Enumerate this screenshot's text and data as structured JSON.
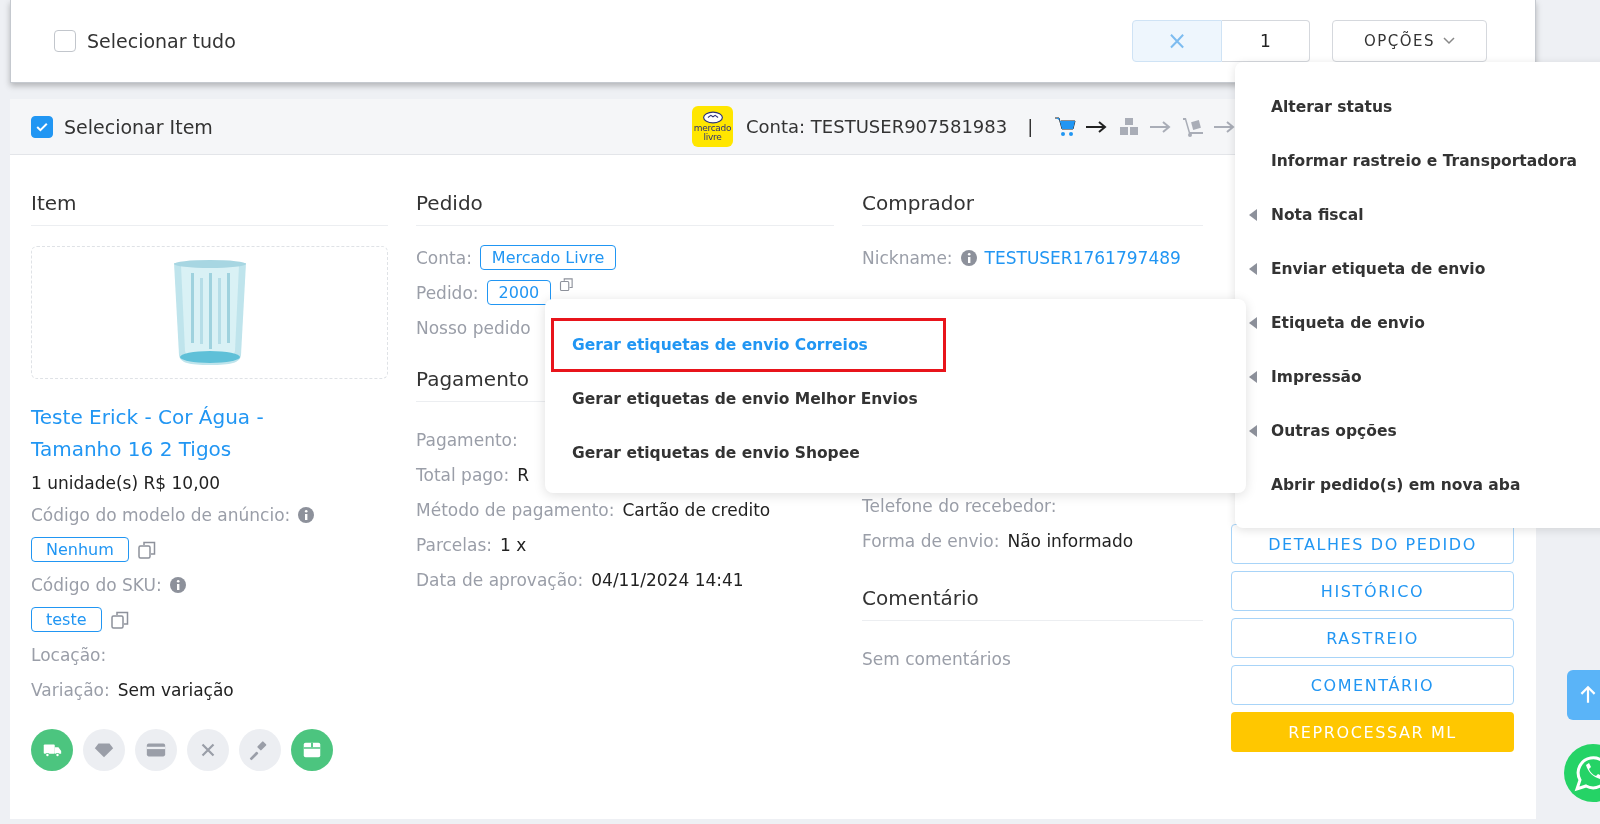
{
  "toolbar": {
    "select_all": {
      "label": "Selecionar tudo",
      "checked": false
    },
    "clear_label": "×",
    "count": "1",
    "options_label": "OPÇÕES"
  },
  "order": {
    "select": {
      "label": "Selecionar Item",
      "checked": true
    },
    "logo_text": "mercado livre",
    "account": "Conta: TESTUSER907581983",
    "separator": "|",
    "status_steps": [
      {
        "kind": "cart",
        "done": true
      },
      {
        "kind": "boxes",
        "done": false
      },
      {
        "kind": "dolly",
        "done": false
      }
    ]
  },
  "item": {
    "title": "Item",
    "product_name": "Teste Erick - Cor Água - Tamanho 16 2 Tigos",
    "quantity_price": "1 unidade(s) R$ 10,00",
    "fields": [
      {
        "kind": "tag",
        "label": "Código do modelo de anúncio:",
        "value": "Nenhum"
      },
      {
        "kind": "tag",
        "label": "Código do SKU:",
        "value": "teste"
      },
      {
        "kind": "plain",
        "label": "Locação:"
      },
      {
        "kind": "plain",
        "label": "Variação:",
        "value": "Sem variação"
      }
    ],
    "action_icons": [
      {
        "kind": "truck",
        "active": true
      },
      {
        "kind": "diamond",
        "active": false
      },
      {
        "kind": "card",
        "active": false
      },
      {
        "kind": "close",
        "active": false
      },
      {
        "kind": "gavel",
        "active": false
      },
      {
        "kind": "box",
        "active": true
      }
    ]
  },
  "order_info": {
    "title": "Pedido",
    "rows": [
      {
        "kind": "tag",
        "label": "Conta:",
        "value": "Mercado Livre"
      },
      {
        "kind": "tag_copy",
        "label": "Pedido:",
        "value": "2000"
      },
      {
        "kind": "plain",
        "label": "Nosso pedido"
      }
    ]
  },
  "payment": {
    "title": "Pagamento",
    "rows": [
      {
        "label": "Pagamento:"
      },
      {
        "label": "Total pago:",
        "value": "R"
      },
      {
        "label": "Método de pagamento:",
        "value": "Cartão de credito"
      },
      {
        "label": "Parcelas:",
        "value": "1 x"
      },
      {
        "label": "Data de aprovação:",
        "value": "04/11/2024 14:41"
      }
    ]
  },
  "buyer": {
    "title": "Comprador",
    "rows": [
      {
        "kind": "link",
        "label": "Nickname:",
        "value": "TESTUSER1761797489"
      }
    ],
    "rows_after": [
      {
        "label": "Telefone do recebedor:"
      },
      {
        "label": "Forma de envio:",
        "value": "Não informado"
      }
    ]
  },
  "comment": {
    "title": "Comentário",
    "text": "Sem comentários"
  },
  "actions": [
    {
      "kind": "outline",
      "label": "DETALHES DO PEDIDO"
    },
    {
      "kind": "outline",
      "label": "HISTÓRICO"
    },
    {
      "kind": "outline",
      "label": "RASTREIO"
    },
    {
      "kind": "outline",
      "label": "COMENTÁRIO"
    },
    {
      "kind": "warning",
      "label": "REPROCESSAR ML"
    }
  ],
  "options_menu": [
    {
      "label": "Alterar status",
      "submenu": false
    },
    {
      "label": "Informar rastreio e Transportadora",
      "submenu": false
    },
    {
      "label": "Nota fiscal",
      "submenu": true
    },
    {
      "label": "Enviar etiqueta de envio",
      "submenu": true
    },
    {
      "label": "Etiqueta de envio",
      "submenu": true
    },
    {
      "label": "Impressão",
      "submenu": true
    },
    {
      "label": "Outras opções",
      "submenu": true
    },
    {
      "label": "Abrir pedido(s) em nova aba",
      "submenu": false
    }
  ],
  "submenu": [
    {
      "label": "Gerar etiquetas de envio Correios",
      "selected": true,
      "outlined": true
    },
    {
      "label": "Gerar etiquetas de envio Melhor Envios",
      "selected": false,
      "outlined": false
    },
    {
      "label": "Gerar etiquetas de envio Shopee",
      "selected": false,
      "outlined": false
    }
  ]
}
